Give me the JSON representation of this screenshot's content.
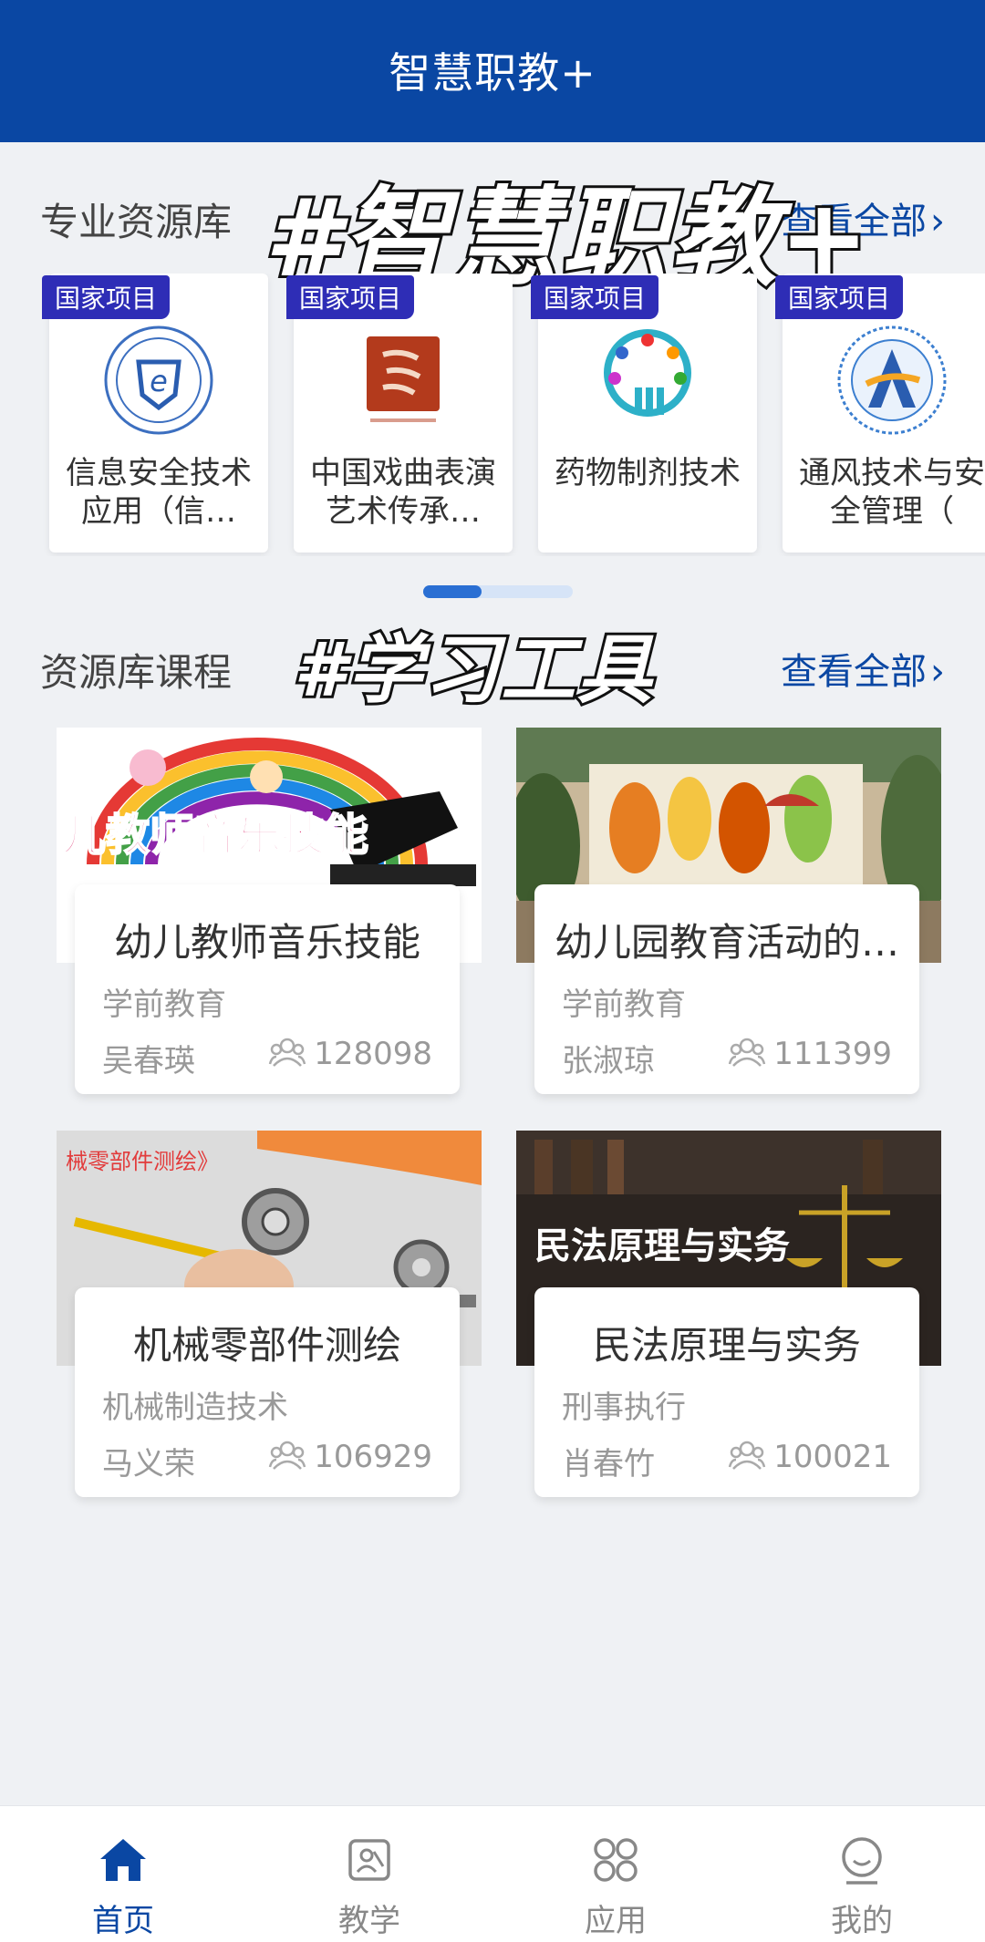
{
  "header": {
    "title": "智慧职教+"
  },
  "overlays": {
    "tag1": "#智慧职教+",
    "tag2": "#学习工具"
  },
  "resource_library": {
    "label": "专业资源库",
    "more": "查看全部",
    "items": [
      {
        "badge": "国家项目",
        "name": "信息安全技术应用（信…",
        "logo": "shield-logo-icon"
      },
      {
        "badge": "国家项目",
        "name": "中国戏曲表演艺术传承…",
        "logo": "red-seal-logo-icon"
      },
      {
        "badge": "国家项目",
        "name": "药物制剂技术",
        "logo": "pharma-logo-icon"
      },
      {
        "badge": "国家项目",
        "name": "通风技术与安全管理（",
        "logo": "ventilation-logo-icon"
      }
    ]
  },
  "courses_section": {
    "label": "资源库课程",
    "more": "查看全部",
    "items": [
      {
        "title": "幼儿教师音乐技能",
        "category": "学前教育",
        "teacher": "吴春瑛",
        "count": "128098",
        "cover_text": "幼儿教师音乐技能"
      },
      {
        "title": "幼儿园教育活动的…",
        "category": "学前教育",
        "teacher": "张淑琼",
        "count": "111399",
        "cover_text": ""
      },
      {
        "title": "机械零部件测绘",
        "category": "机械制造技术",
        "teacher": "马义荣",
        "count": "106929",
        "cover_text": "械零部件测绘》"
      },
      {
        "title": "民法原理与实务",
        "category": "刑事执行",
        "teacher": "肖春竹",
        "count": "100021",
        "cover_text": "民法原理与实务"
      }
    ]
  },
  "tabbar": {
    "items": [
      {
        "label": "首页",
        "icon": "home-icon",
        "active": true
      },
      {
        "label": "教学",
        "icon": "teaching-icon",
        "active": false
      },
      {
        "label": "应用",
        "icon": "apps-icon",
        "active": false
      },
      {
        "label": "我的",
        "icon": "profile-icon",
        "active": false
      }
    ]
  },
  "colors": {
    "brand": "#0a47a3",
    "badge": "#2e2db6",
    "background": "#eff1f4"
  }
}
